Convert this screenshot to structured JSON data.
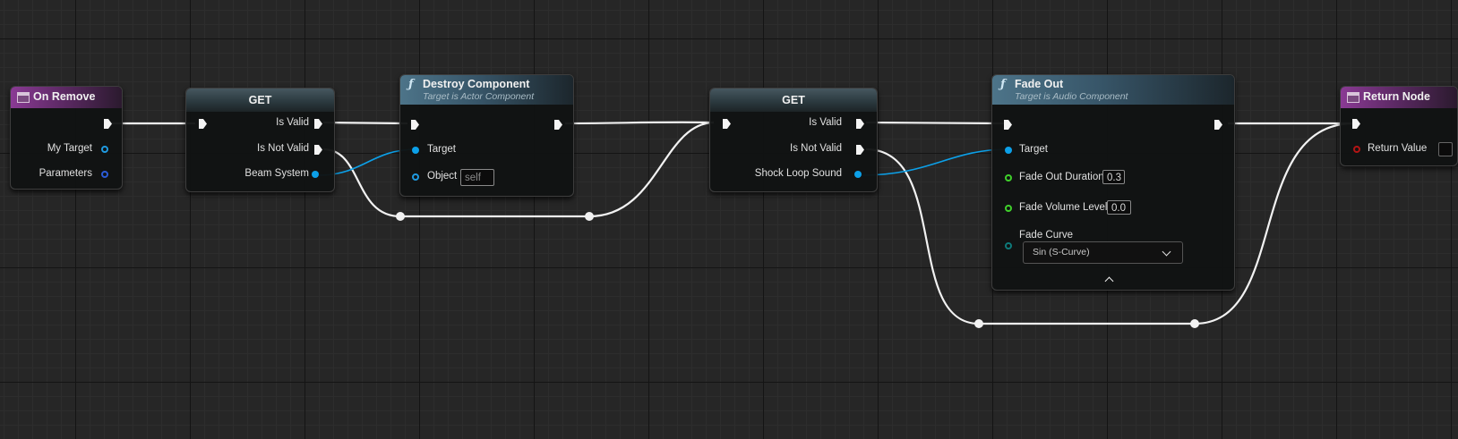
{
  "colors": {
    "exec_wire": "#f2f2f2",
    "object_wire": "#0ca0e8",
    "float_pin": "#3fd02b",
    "event_header": "#8a3a94",
    "function_header": "#4d7489"
  },
  "nodes": {
    "on_remove": {
      "title": "On Remove",
      "pins": [
        "My Target",
        "Parameters"
      ]
    },
    "get1": {
      "title": "GET",
      "pins": [
        "Is Valid",
        "Is Not Valid",
        "Beam System"
      ]
    },
    "destroy": {
      "icon": "ƒ",
      "title": "Destroy Component",
      "subtitle": "Target is Actor Component",
      "pins": [
        "Target",
        "Object"
      ],
      "object_value": "self"
    },
    "get2": {
      "title": "GET",
      "pins": [
        "Is Valid",
        "Is Not Valid",
        "Shock Loop Sound"
      ]
    },
    "fade_out": {
      "icon": "ƒ",
      "title": "Fade Out",
      "subtitle": "Target is Audio Component",
      "pins": [
        "Target",
        "Fade Out Duration",
        "Fade Volume Level",
        "Fade Curve"
      ],
      "fade_out_duration": "0.3",
      "fade_volume_level": "0.0",
      "fade_curve": "Sin (S-Curve)"
    },
    "return_node": {
      "title": "Return Node",
      "pins": [
        "Return Value"
      ]
    }
  }
}
